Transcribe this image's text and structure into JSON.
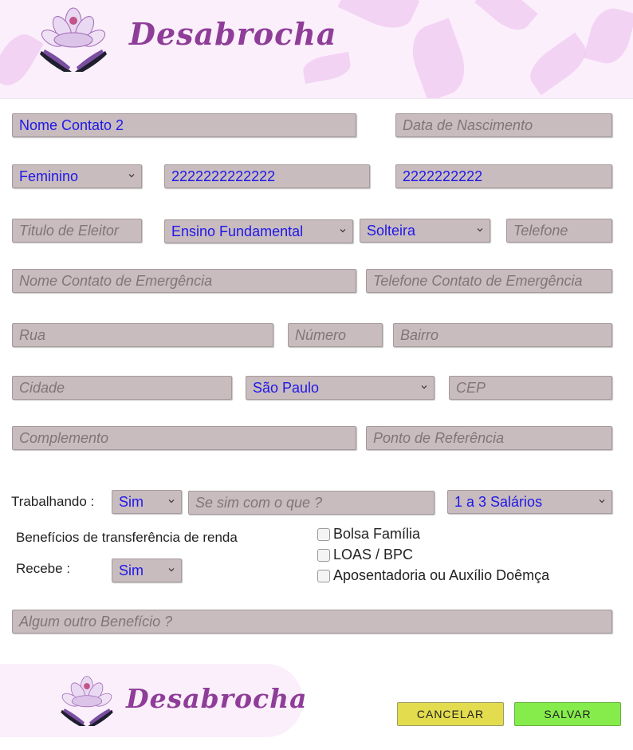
{
  "brand": {
    "name": "Desabrocha",
    "logo_icon": "lotus-hands-icon"
  },
  "form": {
    "nome_contato": "Nome Contato 2",
    "data_nascimento": {
      "placeholder": "Data de Nascimento"
    },
    "genero": "Feminino",
    "campo_numero_1": "2222222222222",
    "campo_numero_2": "2222222222",
    "titulo_eleitor": {
      "placeholder": "Titulo de Eleitor"
    },
    "escolaridade": "Ensino Fundamental",
    "estado_civil": "Solteira",
    "telefone": {
      "placeholder": "Telefone"
    },
    "nome_contato_emergencia": {
      "placeholder": "Nome Contato de Emergência"
    },
    "telefone_contato_emergencia": {
      "placeholder": "Telefone Contato de Emergência"
    },
    "rua": {
      "placeholder": "Rua"
    },
    "numero": {
      "placeholder": "Número"
    },
    "bairro": {
      "placeholder": "Bairro"
    },
    "cidade": {
      "placeholder": "Cidade"
    },
    "estado": "São Paulo",
    "cep": {
      "placeholder": "CEP"
    },
    "complemento": {
      "placeholder": "Complemento"
    },
    "ponto_referencia": {
      "placeholder": "Ponto de Referência"
    },
    "trabalhando_label": "Trabalhando :",
    "trabalhando": "Sim",
    "trabalho_descricao": {
      "placeholder": "Se sim com o que ?"
    },
    "renda": "1 a 3 Salários",
    "beneficios_label": "Benefícios de transferência de renda",
    "recebe_label": "Recebe :",
    "recebe": "Sim",
    "beneficios": [
      {
        "label": "Bolsa Família",
        "checked": false
      },
      {
        "label": "LOAS / BPC",
        "checked": false
      },
      {
        "label": "Aposentadoria ou Auxílio Doêmça",
        "checked": false
      }
    ],
    "outro_beneficio": {
      "placeholder": "Algum outro Benefício ?"
    }
  },
  "actions": {
    "cancel": "CANCELAR",
    "save": "SALVAR"
  },
  "colors": {
    "brand": "#8e3d98",
    "cancel": "#e2dc4e",
    "save": "#86ec4c",
    "field": "#c9bcbe",
    "value_text": "#1f18e8"
  }
}
